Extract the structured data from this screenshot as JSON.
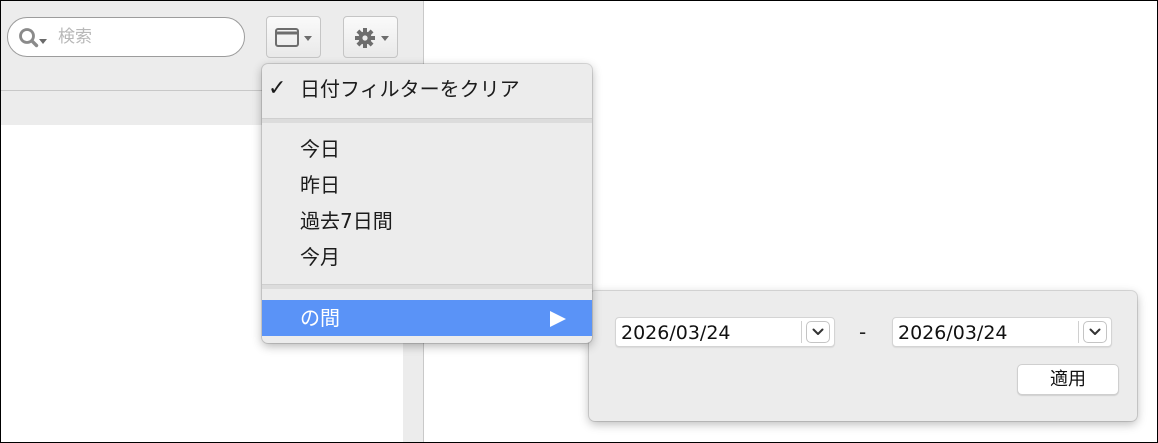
{
  "search": {
    "placeholder": "検索"
  },
  "toolbar": {
    "calendar_icon": "calendar-icon",
    "gear_icon": "gear-icon"
  },
  "date_menu": {
    "clear_filter": "日付フィルターをクリア",
    "clear_checked": "✓",
    "items": [
      "今日",
      "昨日",
      "過去7日間",
      "今月"
    ],
    "between": "の間",
    "between_highlighted": true
  },
  "range_picker": {
    "from": "2026/03/24",
    "to": "2026/03/24",
    "separator": "-",
    "apply_label": "適用"
  },
  "colors": {
    "highlight": "#5a93f7",
    "menu_bg": "#ececec",
    "toolbar_bg": "#ececec"
  }
}
